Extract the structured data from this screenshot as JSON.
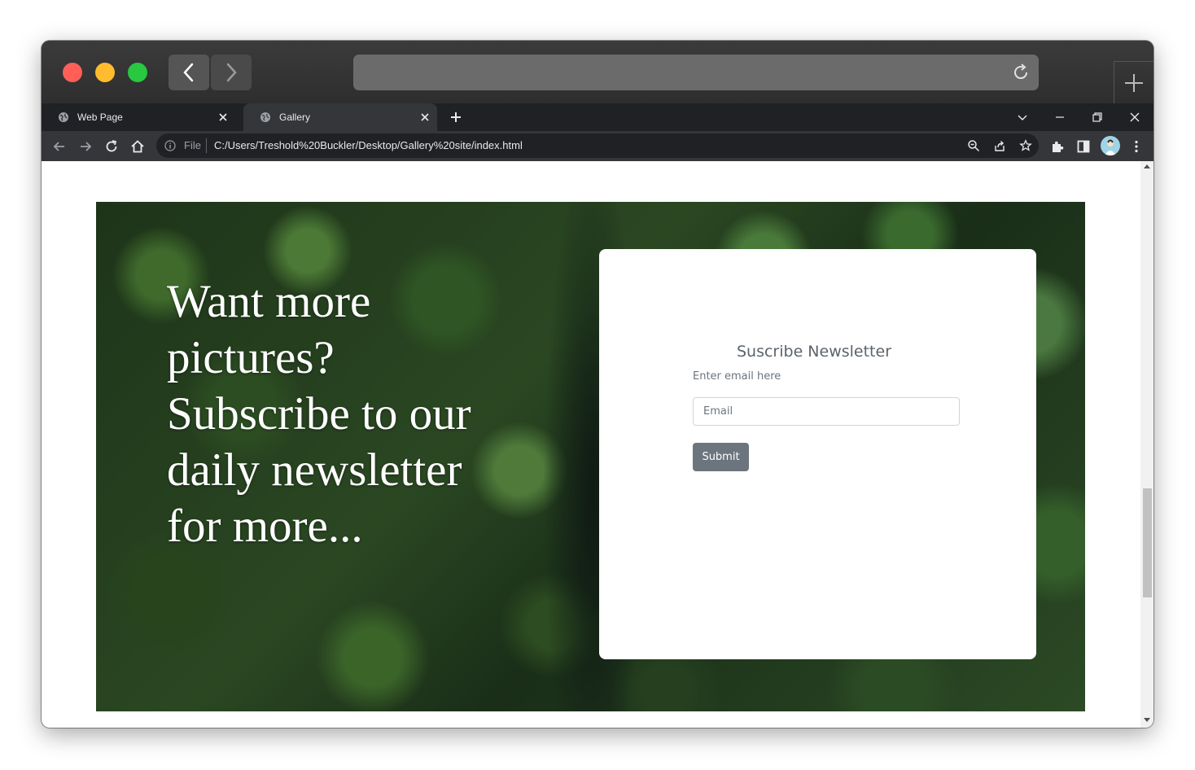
{
  "browser": {
    "tabs": [
      {
        "title": "Web Page",
        "active": false
      },
      {
        "title": "Gallery",
        "active": true
      }
    ],
    "address": {
      "scheme_label": "File",
      "url": "C:/Users/Treshold%20Buckler/Desktop/Gallery%20site/index.html"
    }
  },
  "hero": {
    "headline": "Want more pictures? Subscribe to our daily newsletter for more..."
  },
  "newsletter": {
    "title": "Suscribe Newsletter",
    "label": "Enter email here",
    "email_placeholder": "Email",
    "email_value": "",
    "submit_label": "Submit"
  },
  "colors": {
    "button": "#6c757d",
    "card_title": "#5c636a",
    "browser_frame": "#202124"
  }
}
